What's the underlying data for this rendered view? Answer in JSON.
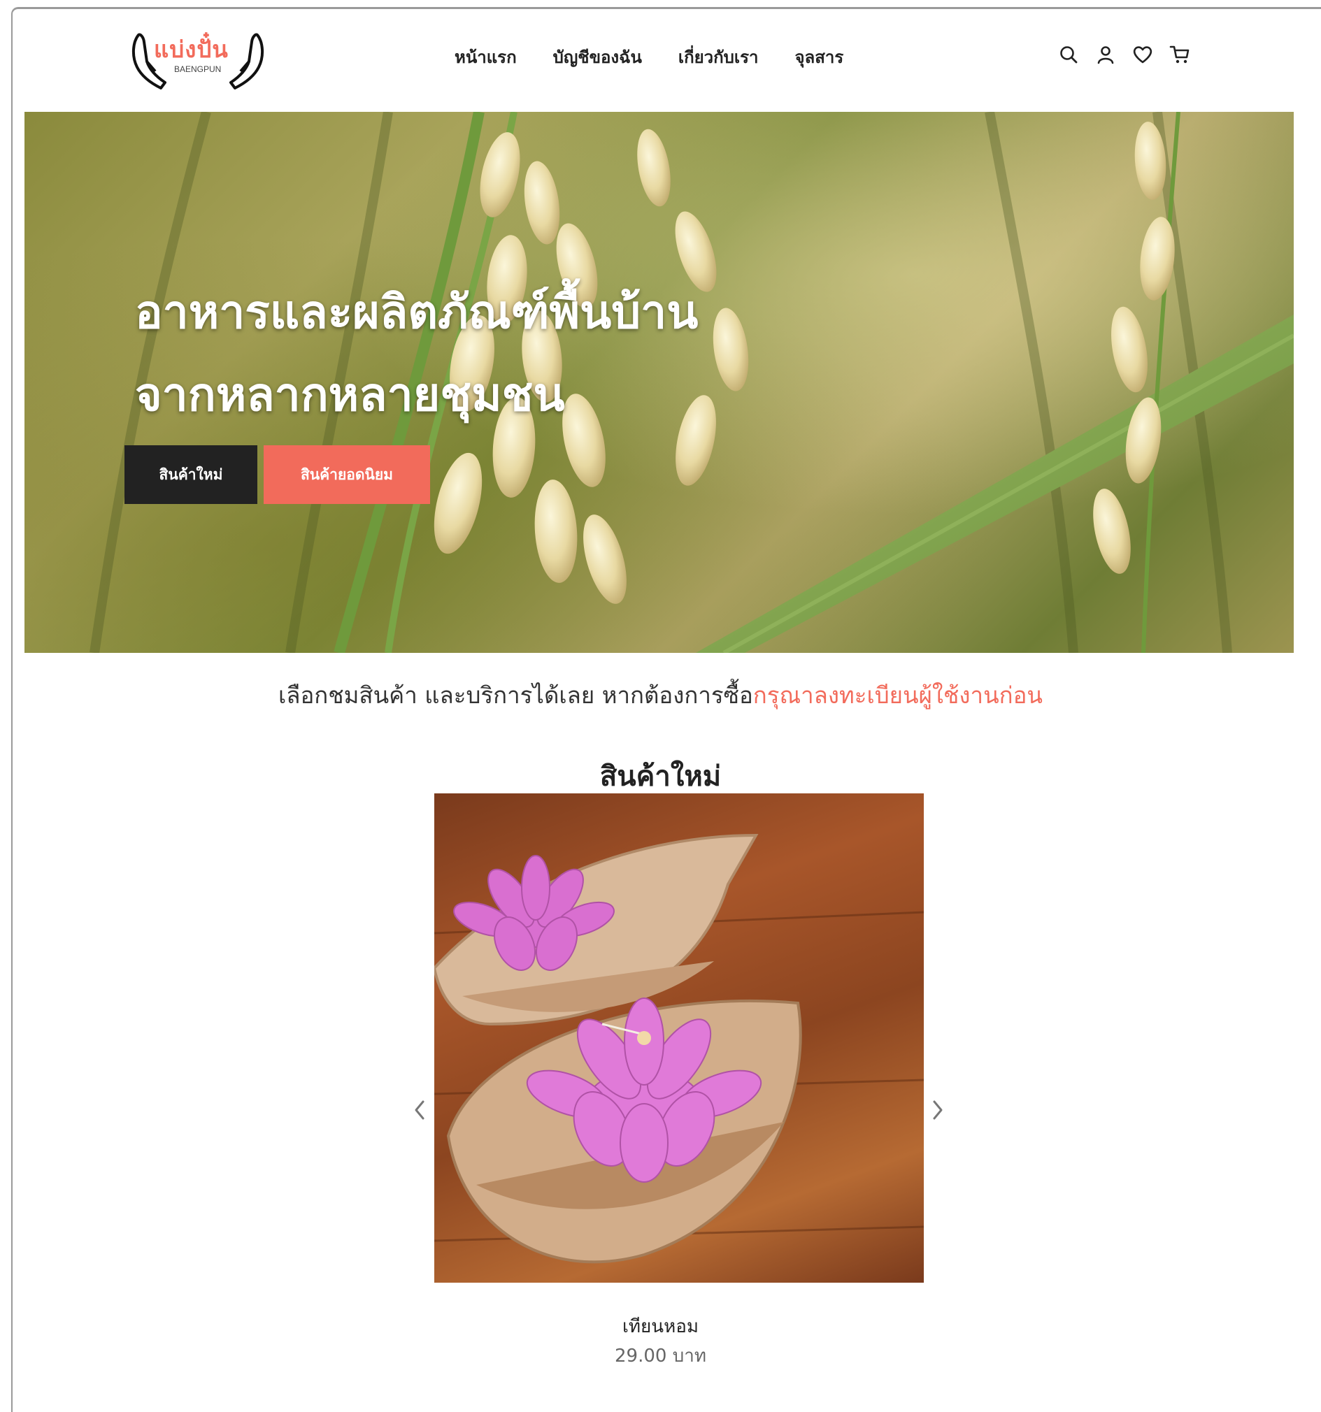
{
  "brand": {
    "logo_text": "แบ่งปั๋น",
    "logo_sub": "BAENGPUN",
    "accent_color": "#f26b5b"
  },
  "nav": {
    "items": [
      {
        "label": "หน้าแรก"
      },
      {
        "label": "บัญชีของฉัน"
      },
      {
        "label": "เกี่ยวกับเรา"
      },
      {
        "label": "จุลสาร"
      }
    ]
  },
  "header_icons": [
    "search-icon",
    "user-icon",
    "heart-icon",
    "cart-icon"
  ],
  "hero": {
    "title_line1": "อาหารและผลิตภัณฑ์พื้นบ้าน",
    "title_line2": "จากหลากหลายชุมชน",
    "btn_new": "สินค้าใหม่",
    "btn_popular": "สินค้ายอดนิยม"
  },
  "intro": {
    "text": "เลือกชมสินค้า และบริการได้เลย หากต้องการซื้อ",
    "link": "กรุณาลงทะเบียนผู้ใช้งานก่อน"
  },
  "new_products": {
    "title": "สินค้าใหม่",
    "items": [
      {
        "name": "เทียนหอม",
        "price": "29.00 บาท"
      }
    ]
  }
}
